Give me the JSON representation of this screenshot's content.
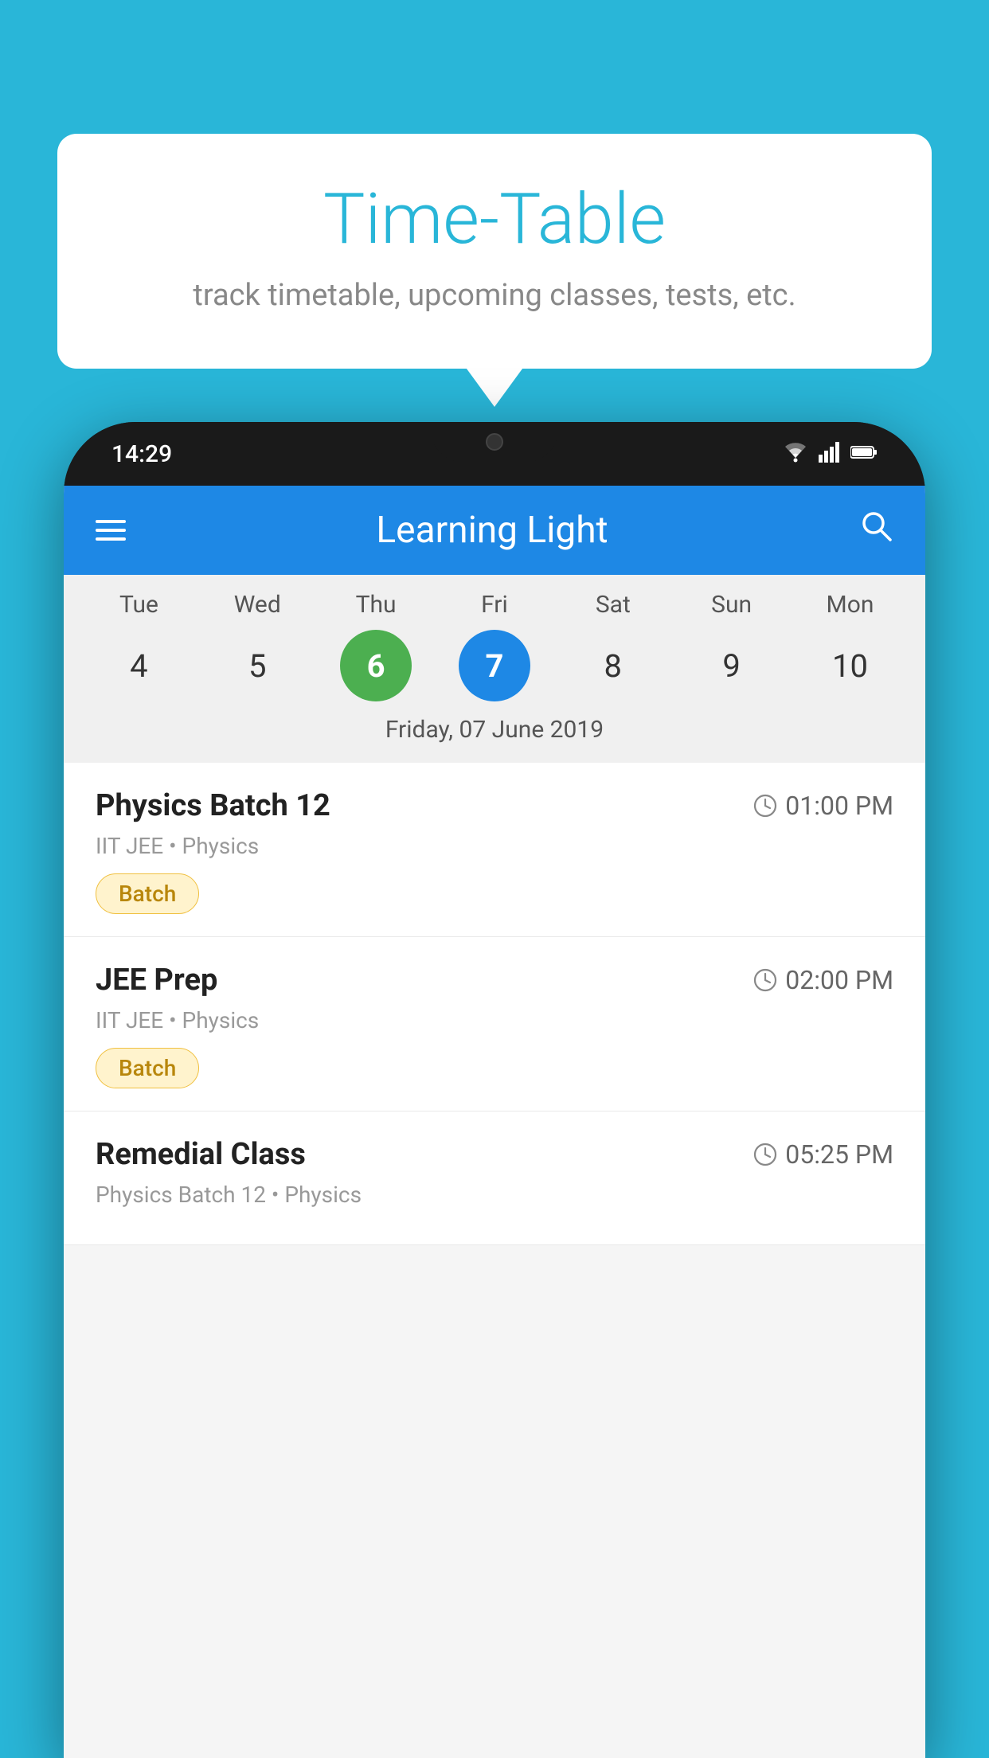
{
  "background_color": "#29b6d8",
  "speech_bubble": {
    "title": "Time-Table",
    "subtitle": "track timetable, upcoming classes, tests, etc."
  },
  "phone": {
    "status_bar": {
      "time": "14:29",
      "wifi": "▾",
      "signal": "◤",
      "battery": "▮"
    },
    "app_header": {
      "title": "Learning Light",
      "menu_icon": "hamburger",
      "search_icon": "search"
    },
    "calendar": {
      "days": [
        {
          "day": "Tue",
          "num": "4",
          "state": "normal"
        },
        {
          "day": "Wed",
          "num": "5",
          "state": "normal"
        },
        {
          "day": "Thu",
          "num": "6",
          "state": "today"
        },
        {
          "day": "Fri",
          "num": "7",
          "state": "selected"
        },
        {
          "day": "Sat",
          "num": "8",
          "state": "normal"
        },
        {
          "day": "Sun",
          "num": "9",
          "state": "normal"
        },
        {
          "day": "Mon",
          "num": "10",
          "state": "normal"
        }
      ],
      "selected_date_label": "Friday, 07 June 2019"
    },
    "classes": [
      {
        "name": "Physics Batch 12",
        "time": "01:00 PM",
        "meta": "IIT JEE • Physics",
        "tag": "Batch"
      },
      {
        "name": "JEE Prep",
        "time": "02:00 PM",
        "meta": "IIT JEE • Physics",
        "tag": "Batch"
      },
      {
        "name": "Remedial Class",
        "time": "05:25 PM",
        "meta": "Physics Batch 12 • Physics",
        "tag": ""
      }
    ]
  }
}
